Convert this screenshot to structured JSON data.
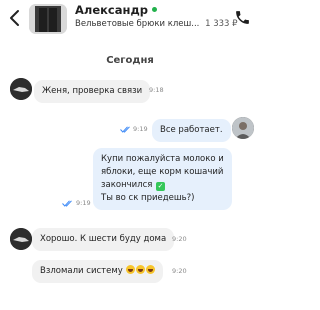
{
  "header": {
    "contact_name": "Александр",
    "listing_title": "Вельветовые брюки клеш...",
    "listing_price": "1 333 ₽",
    "online_color": "#22b14c",
    "back_icon": "chevron-left-icon",
    "call_icon": "phone-icon"
  },
  "date_separator": "Сегодня",
  "messages": [
    {
      "direction": "incoming",
      "text": "Женя, проверка связи",
      "time": "9:18"
    },
    {
      "direction": "outgoing",
      "text": "Все работает.",
      "time": "9:19",
      "status": "read"
    },
    {
      "direction": "outgoing",
      "lines": [
        "Купи пожалуйста молоко и",
        "яблоки, еще корм кошачий",
        "закончился",
        "Ты во ск приедешь?)"
      ],
      "emoji": "check-mark-button",
      "time": "9:19",
      "status": "read"
    },
    {
      "direction": "incoming",
      "text": "Хорошо. К шести буду дома",
      "time": "9:20"
    },
    {
      "direction": "incoming",
      "text": "Взломали систему",
      "emoji": "laughing-face x3",
      "time": "9:20"
    }
  ],
  "colors": {
    "incoming_bubble": "#f1f1f1",
    "outgoing_bubble": "#e6f0fc",
    "read_checks": "#3d8af7"
  }
}
